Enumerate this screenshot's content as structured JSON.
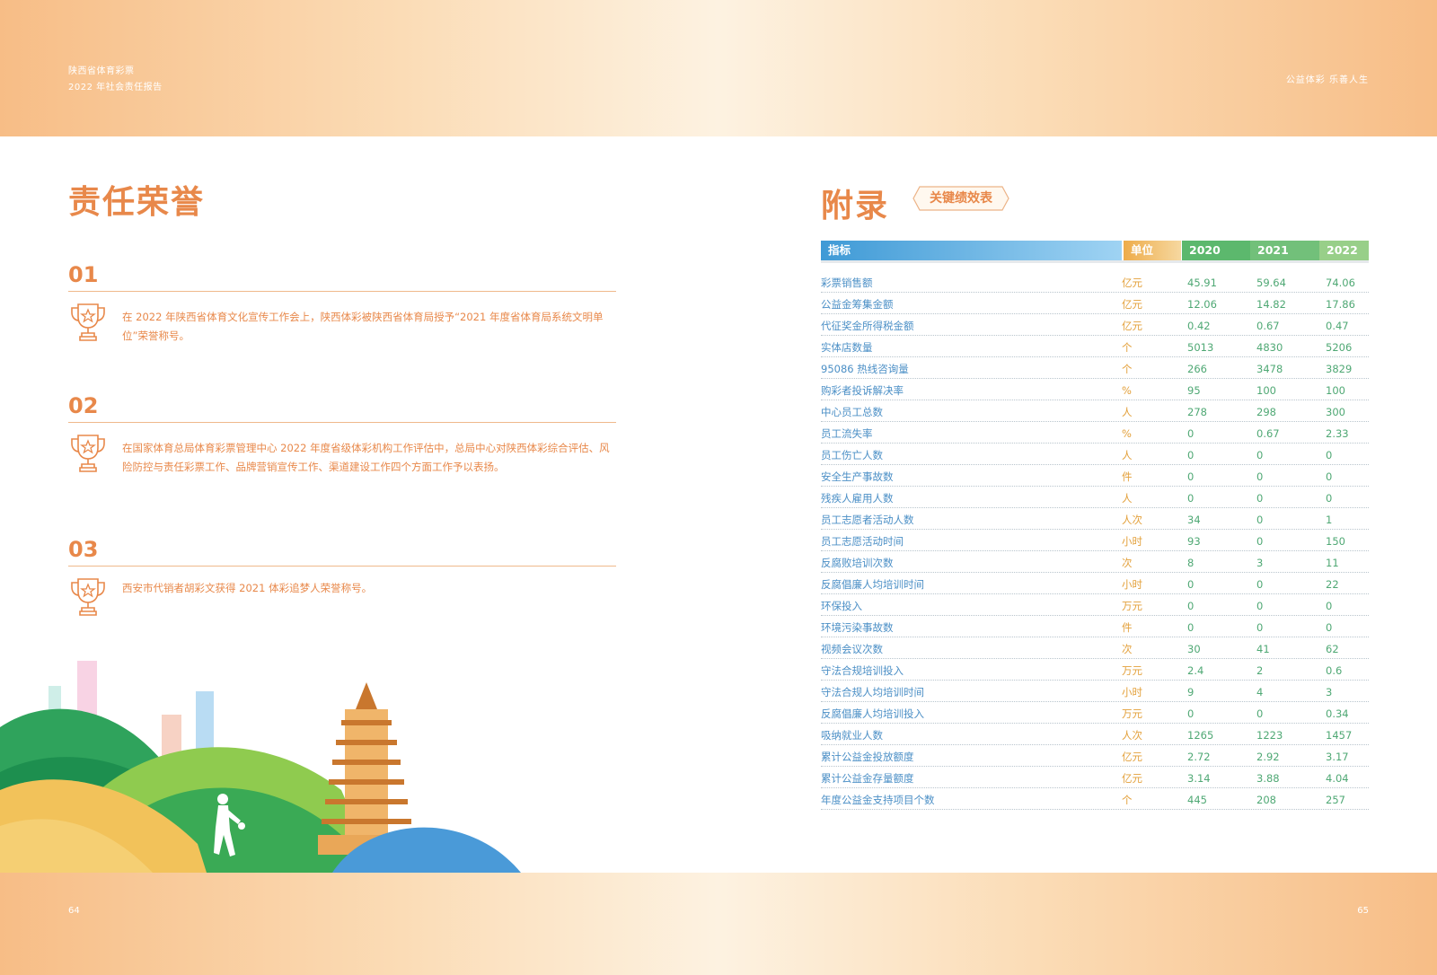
{
  "header": {
    "org": "陕西省体育彩票",
    "report": "2022 年社会责任报告",
    "slogan": "公益体彩  乐善人生"
  },
  "footer": {
    "page_left": "64",
    "page_right": "65"
  },
  "left": {
    "title": "责任荣誉",
    "honors": [
      {
        "num": "01",
        "text": "在 2022 年陕西省体育文化宣传工作会上，陕西体彩被陕西省体育局授予“2021 年度省体育局系统文明单位”荣誉称号。"
      },
      {
        "num": "02",
        "text": "在国家体育总局体育彩票管理中心 2022 年度省级体彩机构工作评估中，总局中心对陕西体彩综合评估、风险防控与责任彩票工作、品牌营销宣传工作、渠道建设工作四个方面工作予以表扬。"
      },
      {
        "num": "03",
        "text": "西安市代销者胡彩文获得 2021 体彩追梦人荣誉称号。"
      }
    ]
  },
  "right": {
    "title": "附录",
    "badge": "关键绩效表",
    "table": {
      "headers": [
        "指标",
        "单位",
        "2020",
        "2021",
        "2022"
      ],
      "rows": [
        [
          "彩票销售额",
          "亿元",
          "45.91",
          "59.64",
          "74.06"
        ],
        [
          "公益金筹集金额",
          "亿元",
          "12.06",
          "14.82",
          "17.86"
        ],
        [
          "代征奖金所得税金额",
          "亿元",
          "0.42",
          "0.67",
          "0.47"
        ],
        [
          "实体店数量",
          "个",
          "5013",
          "4830",
          "5206"
        ],
        [
          "95086 热线咨询量",
          "个",
          "266",
          "3478",
          "3829"
        ],
        [
          "购彩者投诉解决率",
          "%",
          "95",
          "100",
          "100"
        ],
        [
          "中心员工总数",
          "人",
          "278",
          "298",
          "300"
        ],
        [
          "员工流失率",
          "%",
          "0",
          "0.67",
          "2.33"
        ],
        [
          "员工伤亡人数",
          "人",
          "0",
          "0",
          "0"
        ],
        [
          "安全生产事故数",
          "件",
          "0",
          "0",
          "0"
        ],
        [
          "残疾人雇用人数",
          "人",
          "0",
          "0",
          "0"
        ],
        [
          "员工志愿者活动人数",
          "人次",
          "34",
          "0",
          "1"
        ],
        [
          "员工志愿活动时间",
          "小时",
          "93",
          "0",
          "150"
        ],
        [
          "反腐败培训次数",
          "次",
          "8",
          "3",
          "11"
        ],
        [
          "反腐倡廉人均培训时间",
          "小时",
          "0",
          "0",
          "22"
        ],
        [
          "环保投入",
          "万元",
          "0",
          "0",
          "0"
        ],
        [
          "环境污染事故数",
          "件",
          "0",
          "0",
          "0"
        ],
        [
          "视频会议次数",
          "次",
          "30",
          "41",
          "62"
        ],
        [
          "守法合规培训投入",
          "万元",
          "2.4",
          "2",
          "0.6"
        ],
        [
          "守法合规人均培训时间",
          "小时",
          "9",
          "4",
          "3"
        ],
        [
          "反腐倡廉人均培训投入",
          "万元",
          "0",
          "0",
          "0.34"
        ],
        [
          "吸纳就业人数",
          "人次",
          "1265",
          "1223",
          "1457"
        ],
        [
          "累计公益金投放额度",
          "亿元",
          "2.72",
          "2.92",
          "3.17"
        ],
        [
          "累计公益金存量额度",
          "亿元",
          "3.14",
          "3.88",
          "4.04"
        ],
        [
          "年度公益金支持项目个数",
          "个",
          "445",
          "208",
          "257"
        ]
      ]
    }
  },
  "colors": {
    "accent_orange": "#e8884a",
    "table_blue": "#3f9ad6",
    "table_green": "#5cb86d",
    "unit_gold": "#eeac4a"
  }
}
